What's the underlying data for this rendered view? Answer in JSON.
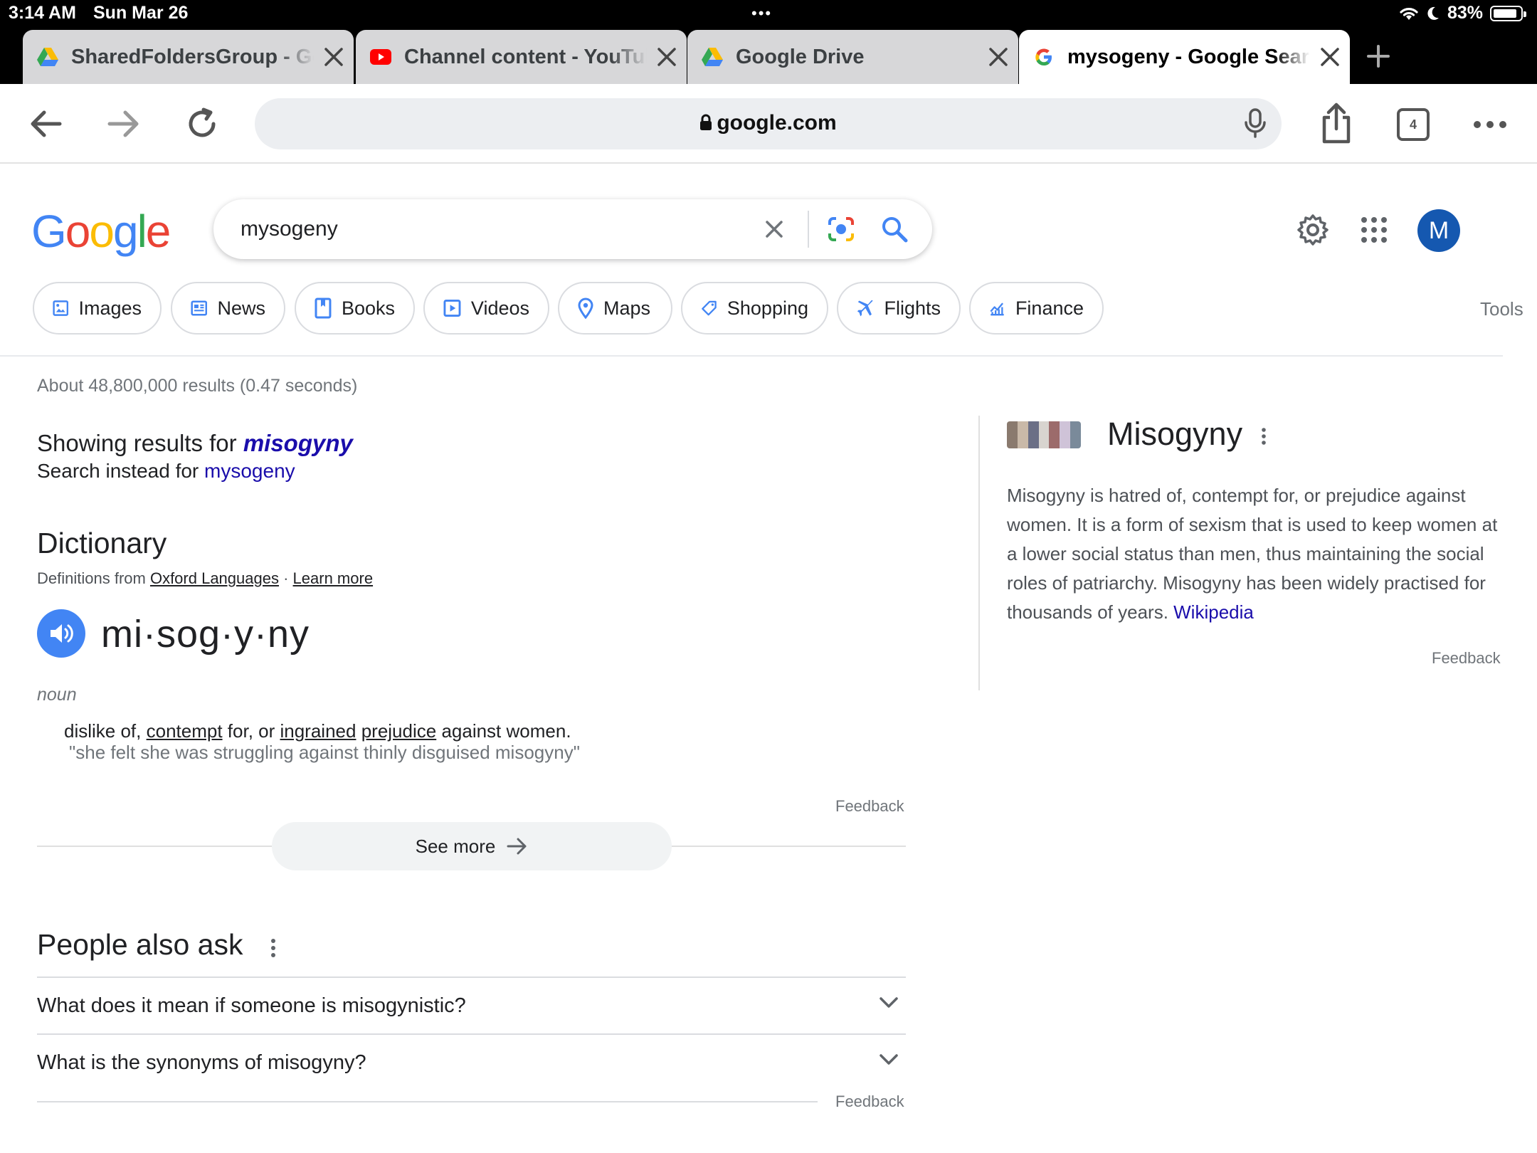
{
  "status_bar": {
    "time": "3:14 AM",
    "date": "Sun Mar 26",
    "battery": "83%",
    "battery_level": 0.83
  },
  "tabs": [
    {
      "title": "SharedFoldersGroup - Google Drive",
      "favicon": "google-drive-icon",
      "active": false
    },
    {
      "title": "Channel content - YouTube Studio",
      "favicon": "youtube-icon",
      "active": false
    },
    {
      "title": "Google Drive",
      "favicon": "google-drive-icon",
      "active": false
    },
    {
      "title": "mysogeny - Google Search",
      "favicon": "google-g-icon",
      "active": true
    }
  ],
  "toolbar": {
    "url": "google.com",
    "tab_count": "4"
  },
  "search": {
    "query": "mysogeny"
  },
  "logo": {
    "text": "Google"
  },
  "profile": {
    "initial": "M",
    "color": "#1558b0"
  },
  "chips": [
    {
      "label": "Images",
      "icon": "image-icon"
    },
    {
      "label": "News",
      "icon": "news-icon"
    },
    {
      "label": "Books",
      "icon": "book-icon"
    },
    {
      "label": "Videos",
      "icon": "video-icon"
    },
    {
      "label": "Maps",
      "icon": "map-pin-icon"
    },
    {
      "label": "Shopping",
      "icon": "tag-icon"
    },
    {
      "label": "Flights",
      "icon": "plane-icon"
    },
    {
      "label": "Finance",
      "icon": "finance-icon"
    }
  ],
  "tools_label": "Tools",
  "results": {
    "stats": "About 48,800,000 results (0.47 seconds)",
    "showing_prefix": "Showing results for ",
    "showing_term": "misogyny",
    "instead_prefix": "Search instead for ",
    "instead_term": "mysogeny"
  },
  "dictionary": {
    "title": "Dictionary",
    "source_prefix": "Definitions from ",
    "source_name": "Oxford Languages",
    "source_sep": " · ",
    "learn_more": "Learn more",
    "headword": "mi·sog·y·ny",
    "part_of_speech": "noun",
    "definition": {
      "w1": "dislike of, ",
      "contempt": "contempt",
      "w2": " for, or ",
      "ingrained": "ingrained",
      "w3": " ",
      "prejudice": "prejudice",
      "w4": " against women."
    },
    "example": "\"she felt she was struggling against thinly disguised misogyny\"",
    "feedback": "Feedback",
    "see_more": "See more"
  },
  "people_also_ask": {
    "title": "People also ask",
    "questions": [
      "What does it mean if someone is misogynistic?",
      "What is the synonyms of misogyny?"
    ],
    "feedback": "Feedback"
  },
  "knowledge_panel": {
    "title": "Misogyny",
    "description": "Misogyny is hatred of, contempt for, or prejudice against women. It is a form of sexism that is used to keep women at a lower social status than men, thus maintaining the social roles of patriarchy. Misogyny has been widely practised for thousands of years. ",
    "source": "Wikipedia",
    "feedback": "Feedback"
  },
  "colors": {
    "link": "#1a0dab",
    "accent_blue": "#4285f4",
    "google_red": "#ea4335",
    "google_yellow": "#fbbc05",
    "google_green": "#34a853"
  }
}
